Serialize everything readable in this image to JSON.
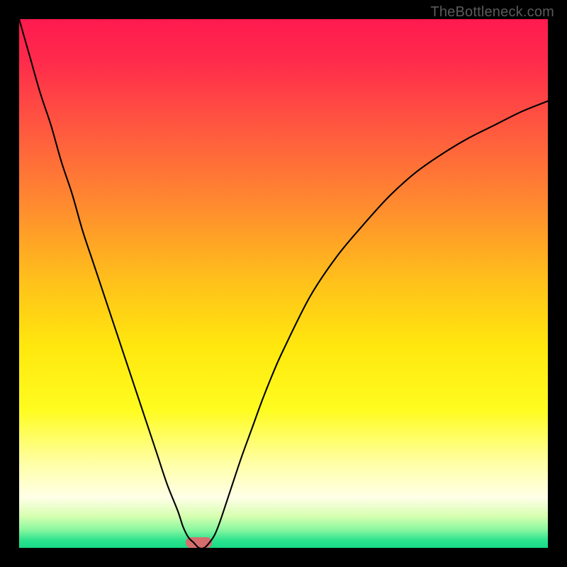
{
  "watermark": {
    "text": "TheBottleneck.com"
  },
  "chart_data": {
    "type": "line",
    "title": "",
    "xlabel": "",
    "ylabel": "",
    "xlim": [
      0,
      100
    ],
    "ylim": [
      0,
      100
    ],
    "grid": false,
    "legend": false,
    "background_gradient_stops": [
      {
        "offset": 0.0,
        "color": "#ff1a4e"
      },
      {
        "offset": 0.08,
        "color": "#ff2b4c"
      },
      {
        "offset": 0.2,
        "color": "#ff5640"
      },
      {
        "offset": 0.35,
        "color": "#ff8a2f"
      },
      {
        "offset": 0.5,
        "color": "#ffc21a"
      },
      {
        "offset": 0.62,
        "color": "#ffe80e"
      },
      {
        "offset": 0.74,
        "color": "#fffc20"
      },
      {
        "offset": 0.84,
        "color": "#ffffa6"
      },
      {
        "offset": 0.905,
        "color": "#ffffe8"
      },
      {
        "offset": 0.94,
        "color": "#d6ffb0"
      },
      {
        "offset": 0.965,
        "color": "#8cf7a0"
      },
      {
        "offset": 0.985,
        "color": "#2fe38e"
      },
      {
        "offset": 1.0,
        "color": "#16da85"
      }
    ],
    "series": [
      {
        "name": "bottleneck-curve",
        "color": "#000000",
        "stroke_width": 2.1,
        "x": [
          0,
          2,
          4,
          6,
          8,
          10,
          12,
          14,
          16,
          18,
          20,
          22,
          24,
          26,
          28,
          30,
          31,
          32,
          33,
          34,
          35,
          36,
          37,
          38,
          40,
          42,
          44,
          46,
          48,
          50,
          55,
          60,
          65,
          70,
          75,
          80,
          85,
          90,
          95,
          100
        ],
        "values": [
          100,
          93,
          86,
          80,
          73,
          67,
          60,
          54,
          48,
          42,
          36,
          30,
          24,
          18,
          12,
          7,
          4,
          2,
          1,
          0,
          0,
          1,
          2.5,
          5,
          11,
          17,
          22.5,
          28,
          33,
          37.5,
          47.5,
          55,
          61,
          66.5,
          71,
          74.5,
          77.5,
          80,
          82.5,
          84.5
        ]
      }
    ],
    "marker": {
      "name": "optimal-marker",
      "x": 34,
      "y": 1,
      "color": "#d56d6d",
      "width_pct": 5.0,
      "height_pct": 1.9
    }
  }
}
